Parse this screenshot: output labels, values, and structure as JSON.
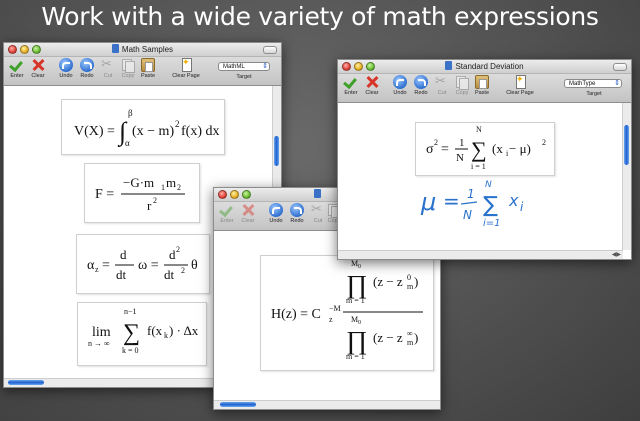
{
  "headline": "Work with a wide variety of math expressions",
  "toolbar_labels": {
    "enter": "Enter",
    "clear": "Clear",
    "undo": "Undo",
    "redo": "Redo",
    "cut": "Cut",
    "copy": "Copy",
    "paste": "Paste",
    "clear_page": "Clear Page",
    "target": "Target"
  },
  "windows": {
    "math_samples": {
      "title": "Math Samples",
      "target_value": "MathML",
      "equations": {
        "variance": {
          "lhs": "V(X) =",
          "integral": "∫",
          "upper": "β",
          "lower": "α",
          "body": "(x − m)",
          "sup": "2",
          "tail": "f(x) dx"
        },
        "force": {
          "lhs": "F =",
          "num": "−G·m",
          "num_sub1": "1",
          "num_m2": "m",
          "num_sub2": "2",
          "den": "r",
          "den_sup": "2"
        },
        "angular": {
          "lhs": "α",
          "lhs_sub": "z",
          "eq1": "=",
          "d_num": "d",
          "d_den": "dt",
          "omega": "ω =",
          "d2_num": "d",
          "d2_num_sup": "2",
          "d2_den": "dt",
          "d2_den_sup": "2",
          "theta": "θ"
        },
        "riemann": {
          "lim": "lim",
          "lim_sub": "n → ∞",
          "sigma": "∑",
          "sigma_upper": "n−1",
          "sigma_lower": "k = 0",
          "body": "f(x",
          "body_sub": "k",
          "tail": ") · Δx"
        }
      }
    },
    "middle": {
      "title": "",
      "equation": {
        "lhs": "H(z) = C",
        "lhs_sub": "z",
        "lhs_sup": "−M",
        "prod": "∏",
        "upper": "M",
        "upper_sub": "0",
        "lower": "m = 1",
        "num_body": "(z − z",
        "num_sub": "m",
        "num_sup": "0",
        "num_close": ")",
        "den_body": "(z − z",
        "den_sub": "m",
        "den_sup": "∞",
        "den_close": ")"
      }
    },
    "standard_deviation": {
      "title": "Standard Deviation",
      "target_value": "MathType",
      "equation": {
        "sigma": "σ",
        "sigma_sup": "2",
        "eq": "=",
        "frac_num": "1",
        "frac_den": "N",
        "sum": "∑",
        "upper": "N",
        "lower": "i = 1",
        "body": "(x",
        "body_sub": "i",
        "body_mid": " − μ)",
        "body_sup": "2"
      },
      "handwriting": {
        "mu": "μ",
        "eq": "=",
        "frac_num": "1",
        "frac_den": "N",
        "sum": "∑",
        "upper": "N",
        "lower": "i=1",
        "x": "x",
        "x_sub": "i"
      }
    }
  }
}
